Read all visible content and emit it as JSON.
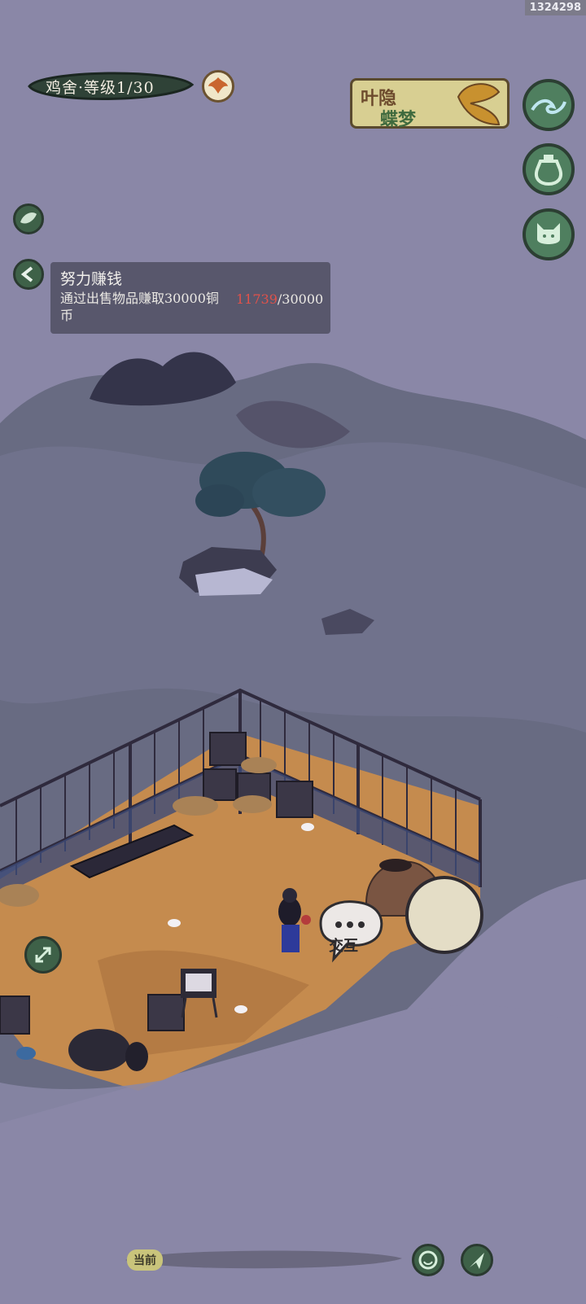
{
  "watermark": "1324298",
  "header": {
    "level_label": "鸡舍·等级1/30"
  },
  "event_banner": {
    "line1": "叶隐",
    "line2": "蝶梦"
  },
  "right_menu": [
    {
      "name": "wave-icon"
    },
    {
      "name": "pot-icon"
    },
    {
      "name": "cat-icon"
    }
  ],
  "quest": {
    "title": "努力赚钱",
    "description": "通过出售物品赚取30000铜币",
    "progress_current": "11739",
    "progress_total": "/30000"
  },
  "interact": {
    "label": "交互"
  },
  "bottom_bar": {
    "tag": "当前"
  },
  "colors": {
    "background": "#8a87a7",
    "fog": "#6b6b85",
    "straw": "#c58b4e",
    "fence": "#2f2a3d",
    "accent_green": "#4f7f5f",
    "progress_red": "#e0524a"
  }
}
